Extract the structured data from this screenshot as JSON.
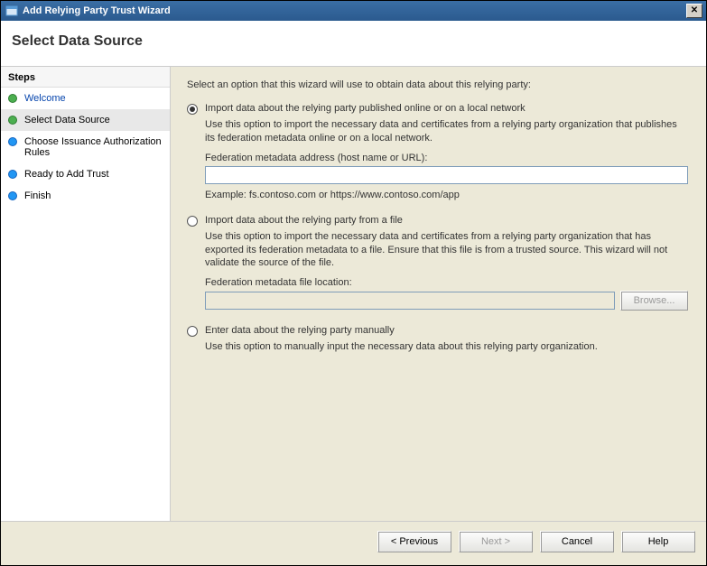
{
  "window": {
    "title": "Add Relying Party Trust Wizard"
  },
  "header": {
    "title": "Select Data Source"
  },
  "sidebar": {
    "heading": "Steps",
    "items": [
      {
        "label": "Welcome",
        "bullet": "green",
        "link": true,
        "active": false
      },
      {
        "label": "Select Data Source",
        "bullet": "green",
        "link": false,
        "active": true
      },
      {
        "label": "Choose Issuance Authorization Rules",
        "bullet": "blue",
        "link": false,
        "active": false
      },
      {
        "label": "Ready to Add Trust",
        "bullet": "blue",
        "link": false,
        "active": false
      },
      {
        "label": "Finish",
        "bullet": "blue",
        "link": false,
        "active": false
      }
    ]
  },
  "content": {
    "intro": "Select an option that this wizard will use to obtain data about this relying party:",
    "opt1": {
      "title": "Import data about the relying party published online or on a local network",
      "desc": "Use this option to import the necessary data and certificates from a relying party organization that publishes its federation metadata online or on a local network.",
      "fieldLabel": "Federation metadata address (host name or URL):",
      "fieldValue": "",
      "example": "Example: fs.contoso.com or https://www.contoso.com/app"
    },
    "opt2": {
      "title": "Import data about the relying party from a file",
      "desc": "Use this option to import the necessary data and certificates from a relying party organization that has exported its federation metadata to a file. Ensure that this file is from a trusted source.  This wizard will not validate the source of the file.",
      "fieldLabel": "Federation metadata file location:",
      "fieldValue": "",
      "browse": "Browse..."
    },
    "opt3": {
      "title": "Enter data about the relying party manually",
      "desc": "Use this option to manually input the necessary data about this relying party organization."
    }
  },
  "footer": {
    "previous": "< Previous",
    "next": "Next >",
    "cancel": "Cancel",
    "help": "Help"
  }
}
